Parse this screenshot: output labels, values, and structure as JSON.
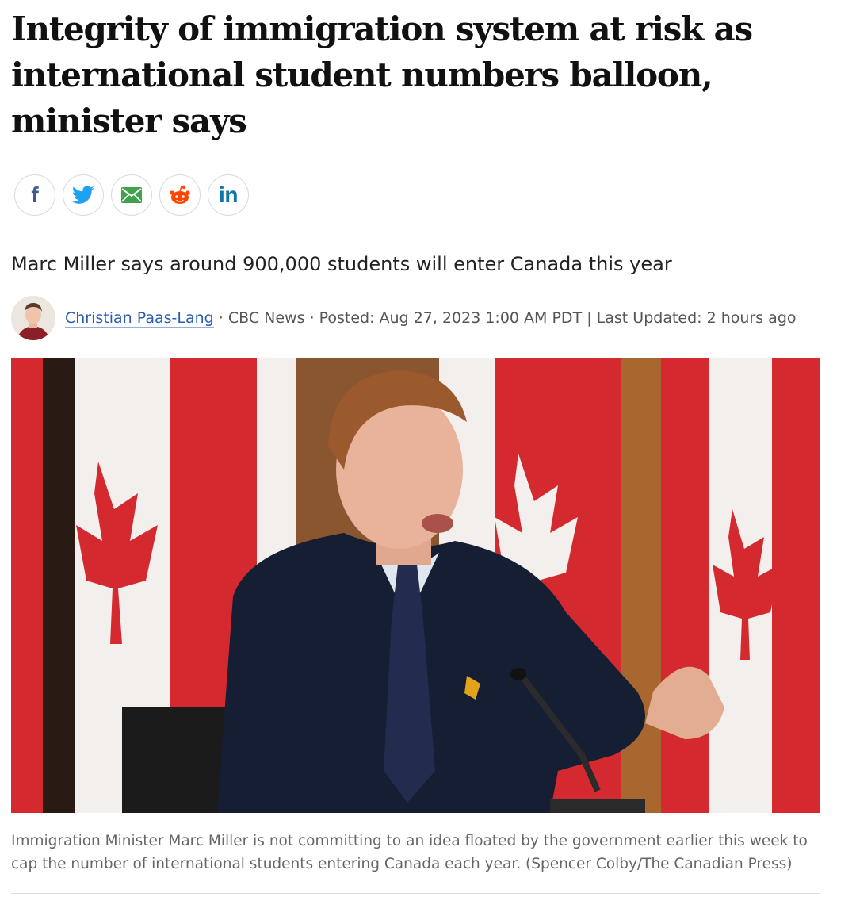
{
  "article": {
    "headline": "Integrity of immigration system at risk as international student numbers balloon, minister says",
    "deck": "Marc Miller says around 900,000 students will enter Canada this year",
    "byline": {
      "author": "Christian Paas-Lang",
      "separator1": " · ",
      "outlet": "CBC News",
      "separator2": " · ",
      "posted": "Posted: Aug 27, 2023 1:00 AM PDT",
      "separator3": " | ",
      "updated": "Last Updated: 2 hours ago"
    },
    "image_caption": "Immigration Minister Marc Miller is not committing to an idea floated by the government earlier this week to cap the number of international students entering Canada each year. (Spencer Colby/The Canadian Press)"
  },
  "share": {
    "facebook_label": "f",
    "linkedin_label": "in",
    "icons": [
      "facebook-icon",
      "twitter-icon",
      "email-icon",
      "reddit-icon",
      "linkedin-icon"
    ],
    "colors": {
      "facebook": "#3b5998",
      "twitter": "#1da1f2",
      "email": "#3fa34d",
      "reddit": "#ff4500",
      "linkedin": "#0e76a8"
    }
  },
  "colors": {
    "author_link": "#2a5db0",
    "flag_red": "#d42a2f"
  }
}
